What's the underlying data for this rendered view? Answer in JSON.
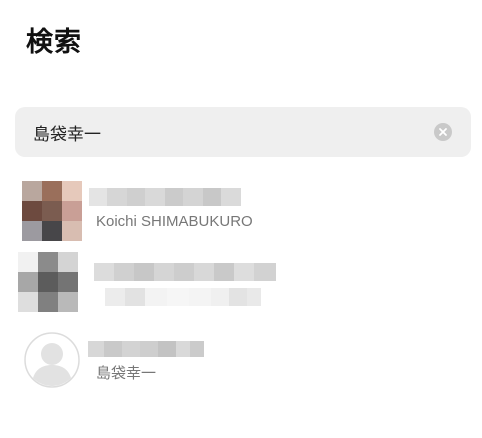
{
  "page": {
    "title": "検索"
  },
  "search": {
    "value": "島袋幸一",
    "placeholder": ""
  },
  "results": [
    {
      "subtitle": "Koichi SHIMABUKURO"
    },
    {
      "subtitle": ""
    },
    {
      "subtitle": "島袋幸一"
    }
  ],
  "icons": {
    "clear": "clear-circle-icon",
    "default_avatar": "person-icon"
  },
  "colors": {
    "search_bg": "#efefef",
    "clear_icon": "#c9c9c9",
    "subtitle": "#777777"
  }
}
